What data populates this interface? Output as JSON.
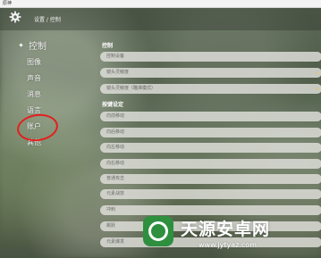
{
  "window": {
    "title": "原神"
  },
  "header": {
    "breadcrumb": "设置 / 控制"
  },
  "sidebar": {
    "items": [
      {
        "label": "控制",
        "active": true
      },
      {
        "label": "图像"
      },
      {
        "label": "声音"
      },
      {
        "label": "消息"
      },
      {
        "label": "语言"
      },
      {
        "label": "账户"
      },
      {
        "label": "其他"
      }
    ]
  },
  "main": {
    "section_control": {
      "title": "控制"
    },
    "control_rows": [
      {
        "label": "控制设备"
      },
      {
        "label": "镜头灵敏度"
      },
      {
        "label": "镜头灵敏度（瞄准模式）"
      }
    ],
    "section_keys": {
      "title": "按键设定"
    },
    "key_rows": [
      {
        "label": "向前移动"
      },
      {
        "label": "向后移动"
      },
      {
        "label": "向左移动"
      },
      {
        "label": "向右移动"
      },
      {
        "label": "普通攻击"
      },
      {
        "label": "元素战技"
      },
      {
        "label": "冲刺"
      },
      {
        "label": "跳跃"
      },
      {
        "label": "元素爆发"
      }
    ]
  },
  "watermark": {
    "title": "天源安卓网",
    "url": "www.jytyaz.com"
  },
  "colors": {
    "highlight_circle": "#e32020",
    "row_bg": "#e1e1dc",
    "watermark_green": "#2e8f3e"
  }
}
